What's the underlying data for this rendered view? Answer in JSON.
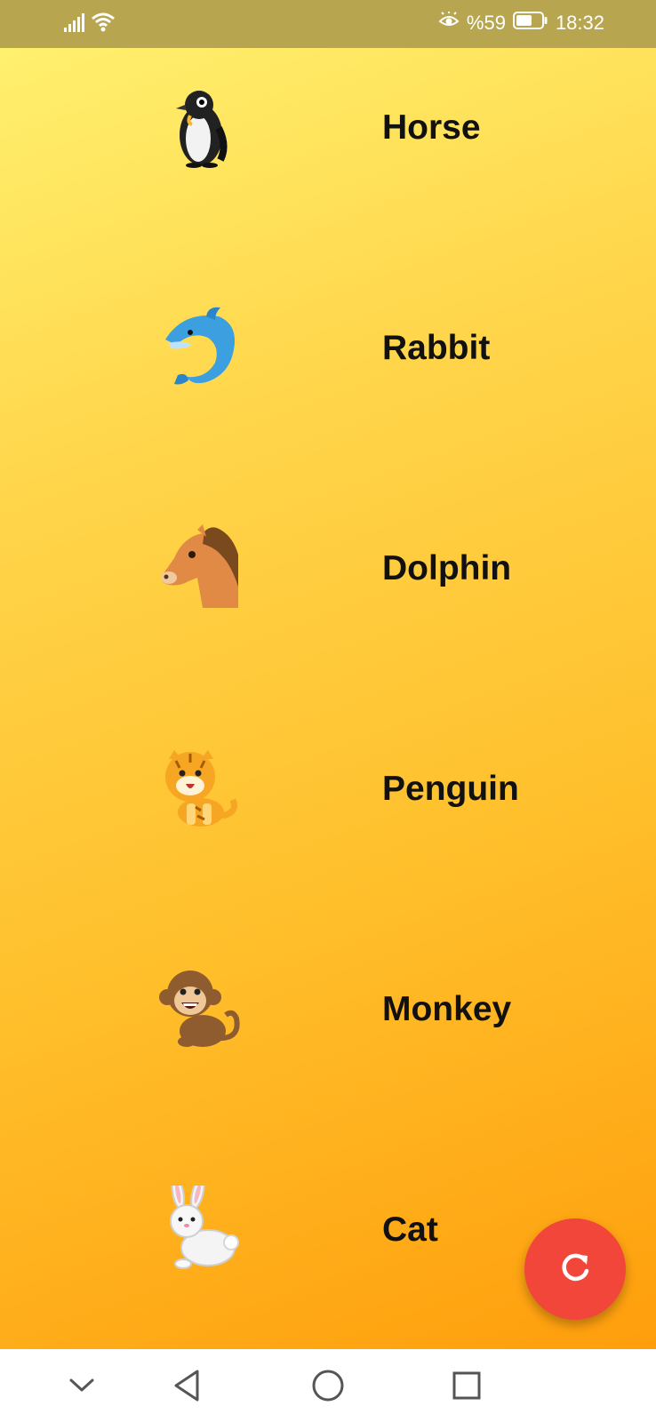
{
  "status_bar": {
    "battery_percent": "%59",
    "time": "18:32",
    "icons": [
      "signal-icon",
      "wifi-icon",
      "eye-comfort-icon",
      "battery-icon"
    ]
  },
  "animal_list": [
    {
      "emoji": "penguin",
      "label": "Horse"
    },
    {
      "emoji": "dolphin",
      "label": "Rabbit"
    },
    {
      "emoji": "horse",
      "label": " Dolphin"
    },
    {
      "emoji": "tiger",
      "label": "Penguin"
    },
    {
      "emoji": "monkey",
      "label": "Monkey"
    },
    {
      "emoji": "rabbit",
      "label": "Cat"
    }
  ],
  "fab": {
    "icon": "refresh-icon"
  },
  "nav_bar": {
    "icons": [
      "chevron-down-icon",
      "back-icon",
      "home-icon",
      "recents-icon"
    ]
  },
  "colors": {
    "status_bar_bg": "#b7a64f",
    "gradient_top": "#fff06e",
    "gradient_bottom": "#ff9e0c",
    "fab_bg": "#f2463a",
    "text": "#111111"
  }
}
